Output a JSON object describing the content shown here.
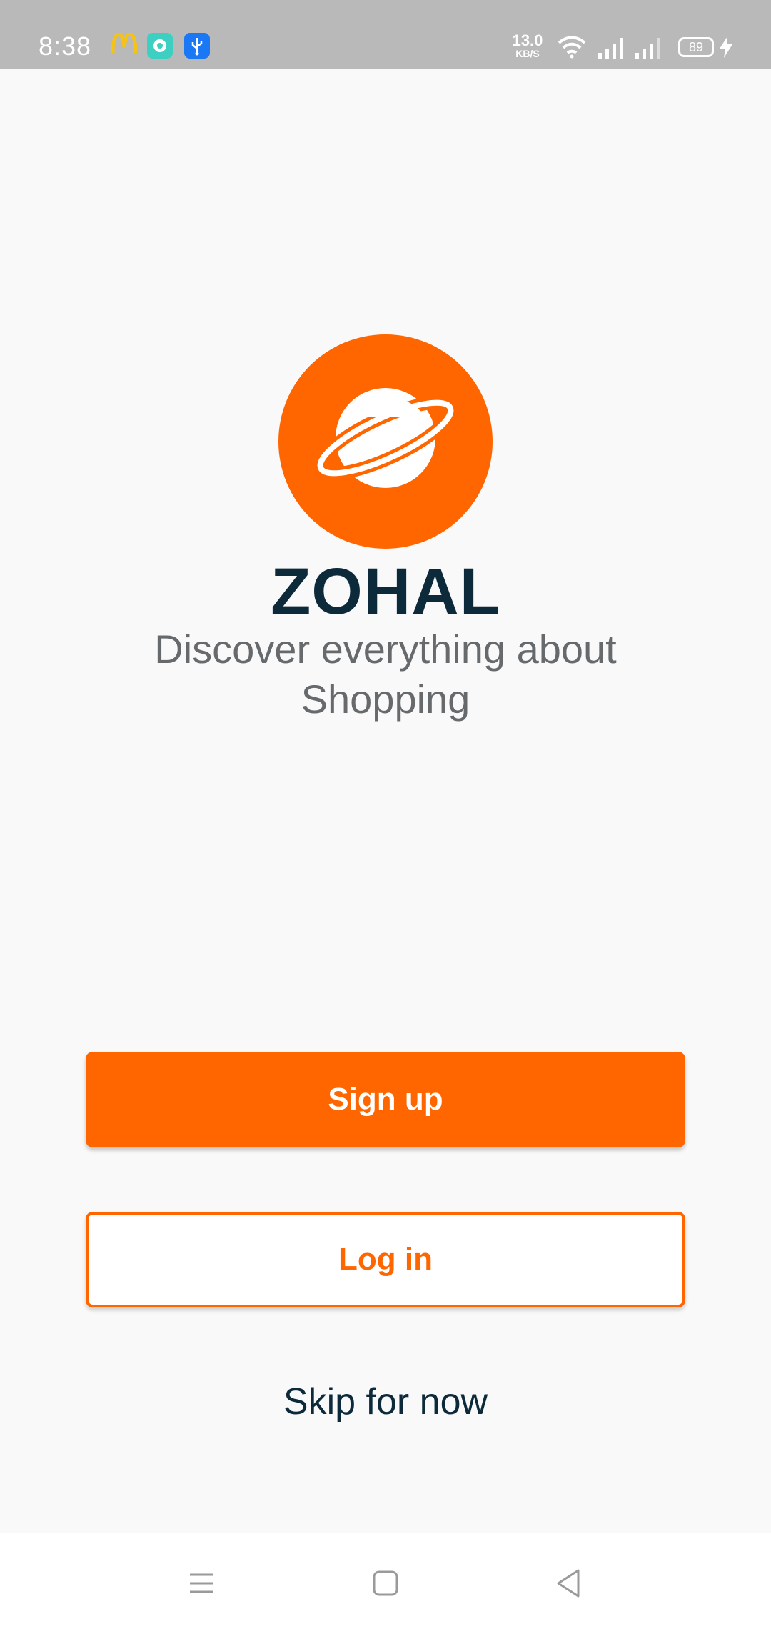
{
  "status_bar": {
    "time": "8:38",
    "net_speed_value": "13.0",
    "net_speed_unit": "KB/S",
    "battery_level": "89",
    "notification_icons": [
      "mcdonalds-icon",
      "chat-app-icon",
      "usb-icon"
    ],
    "status_icons": [
      "wifi-icon",
      "signal-icon",
      "signal-icon",
      "battery-icon",
      "charging-icon"
    ]
  },
  "brand": {
    "logo_icon": "planet-icon",
    "name": "ZOHAL",
    "tagline": "Discover everything about Shopping"
  },
  "actions": {
    "signup_label": "Sign up",
    "login_label": "Log in",
    "skip_label": "Skip for now"
  },
  "nav_bar": {
    "items": [
      "menu-icon",
      "home-icon",
      "back-icon"
    ]
  },
  "colors": {
    "accent": "#ff6600",
    "title": "#0d2a3b",
    "tagline": "#666a6d",
    "background": "#f9f9f9",
    "status_bar": "#b9b9b9"
  }
}
